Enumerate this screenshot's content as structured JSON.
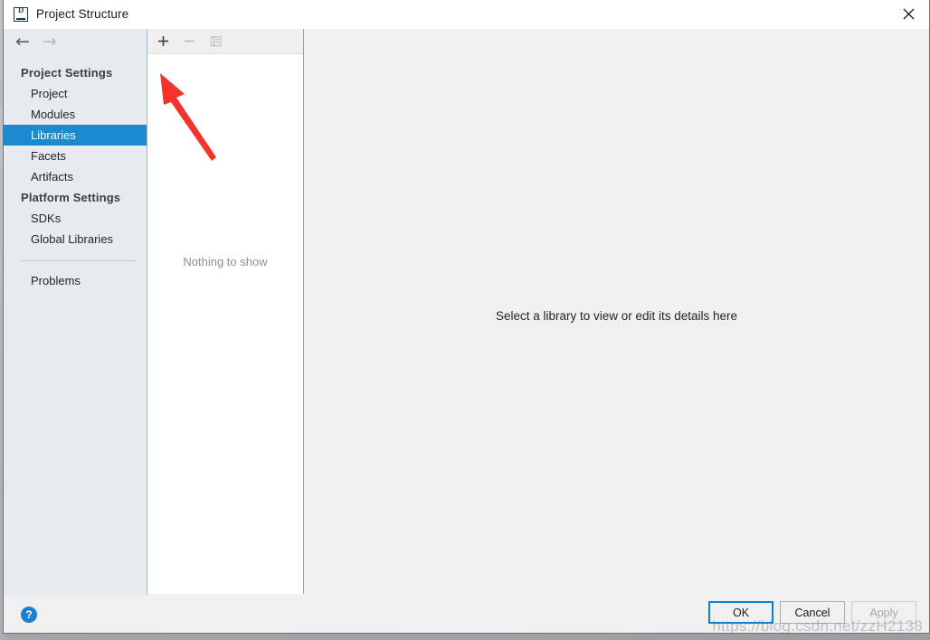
{
  "window": {
    "title": "Project Structure",
    "app_icon": "intellij-idea-icon",
    "close_icon": "close-icon"
  },
  "navigation": {
    "back_icon": "arrow-left-icon",
    "back_glyph": "←",
    "forward_icon": "arrow-right-icon",
    "forward_glyph": "→"
  },
  "sidebar": {
    "groups": [
      {
        "title": "Project Settings",
        "items": [
          {
            "label": "Project",
            "selected": false
          },
          {
            "label": "Modules",
            "selected": false
          },
          {
            "label": "Libraries",
            "selected": true
          },
          {
            "label": "Facets",
            "selected": false
          },
          {
            "label": "Artifacts",
            "selected": false
          }
        ]
      },
      {
        "title": "Platform Settings",
        "items": [
          {
            "label": "SDKs",
            "selected": false
          },
          {
            "label": "Global Libraries",
            "selected": false
          }
        ]
      }
    ],
    "extra_items": [
      {
        "label": "Problems",
        "selected": false
      }
    ],
    "selected_color": "#1b8ad0"
  },
  "list_panel": {
    "toolbar": [
      {
        "name": "add-button",
        "icon": "plus-icon",
        "enabled": true
      },
      {
        "name": "remove-button",
        "icon": "minus-icon",
        "enabled": false
      },
      {
        "name": "copy-button",
        "icon": "copy-icon",
        "enabled": false
      }
    ],
    "empty_text": "Nothing to show"
  },
  "detail_panel": {
    "message": "Select a library to view or edit its details here"
  },
  "footer": {
    "help_icon": "help-circle-icon",
    "help_label": "?",
    "buttons": [
      {
        "label": "OK",
        "state": "focused"
      },
      {
        "label": "Cancel",
        "state": "normal"
      },
      {
        "label": "Apply",
        "state": "disabled"
      }
    ]
  },
  "annotation": {
    "arrow_icon": "red-arrow-annotation",
    "color": "#f4342c",
    "points_to": "add-button"
  },
  "watermark": {
    "text": "https://blog.csdn.net/zzH2138"
  }
}
